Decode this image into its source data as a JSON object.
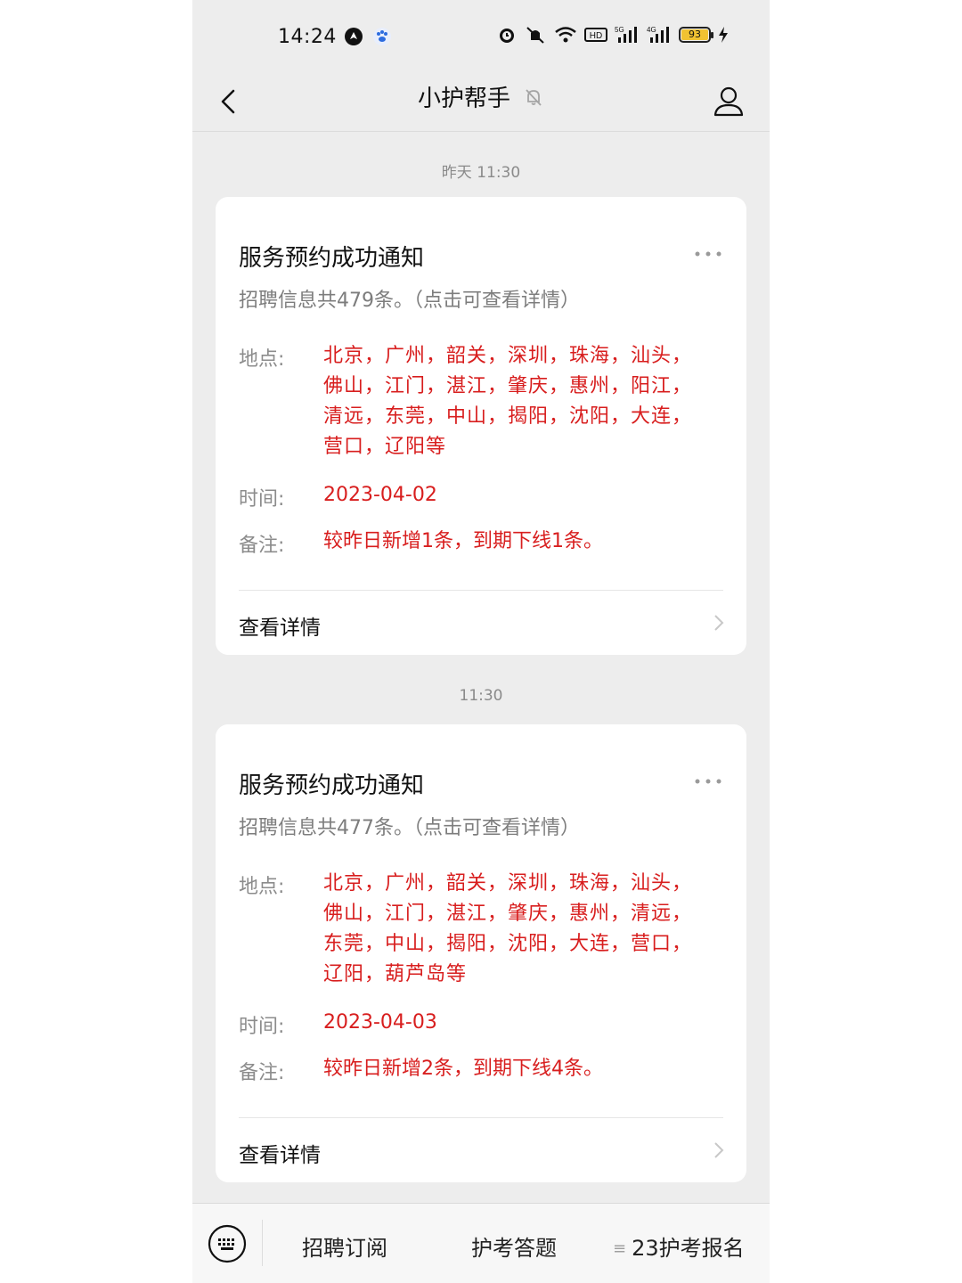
{
  "status_bar": {
    "time": "14:24",
    "battery": "93",
    "icons": [
      "app-notification-icon",
      "baidu-paw-icon",
      "alarm-icon",
      "mute-icon",
      "wifi-icon",
      "hd-icon",
      "signal-5g-icon",
      "signal-4g-icon",
      "battery-icon",
      "charging-icon"
    ]
  },
  "nav": {
    "title": "小护帮手",
    "icons": [
      "back-chevron-icon",
      "bell-muted-icon",
      "profile-icon"
    ]
  },
  "messages": [
    {
      "timestamp": "昨天 11:30",
      "title": "服务预约成功通知",
      "subtitle": "招聘信息共479条。（点击可查看详情）",
      "location_label": "地点:",
      "location_lines": [
        "北京，广州，韶关，深圳，珠海，汕头，",
        "佛山，江门，湛江，肇庆，惠州，阳江，",
        "清远，东莞，中山，揭阳，沈阳，大连，",
        "营口，辽阳等"
      ],
      "time_label": "时间:",
      "time_value": "2023-04-02",
      "note_label": "备注:",
      "note_value": "较昨日新增1条，到期下线1条。",
      "detail_label": "查看详情"
    },
    {
      "timestamp": "11:30",
      "title": "服务预约成功通知",
      "subtitle": "招聘信息共477条。（点击可查看详情）",
      "location_label": "地点:",
      "location_lines": [
        "北京，广州，韶关，深圳，珠海，汕头，",
        "佛山，江门，湛江，肇庆，惠州，清远，",
        "东莞，中山，揭阳，沈阳，大连，营口，",
        "辽阳，葫芦岛等"
      ],
      "time_label": "时间:",
      "time_value": "2023-04-03",
      "note_label": "备注:",
      "note_value": "较昨日新增2条，到期下线4条。",
      "detail_label": "查看详情"
    }
  ],
  "bottom_menu": {
    "items": [
      "招聘订阅",
      "护考答题",
      "23护考报名"
    ],
    "icons": [
      "keyboard-icon",
      "submenu-lines-icon"
    ]
  },
  "colors": {
    "background": "#ededed",
    "card": "#ffffff",
    "accent_red": "#d81e1e",
    "label_gray": "#8c8c8c"
  }
}
